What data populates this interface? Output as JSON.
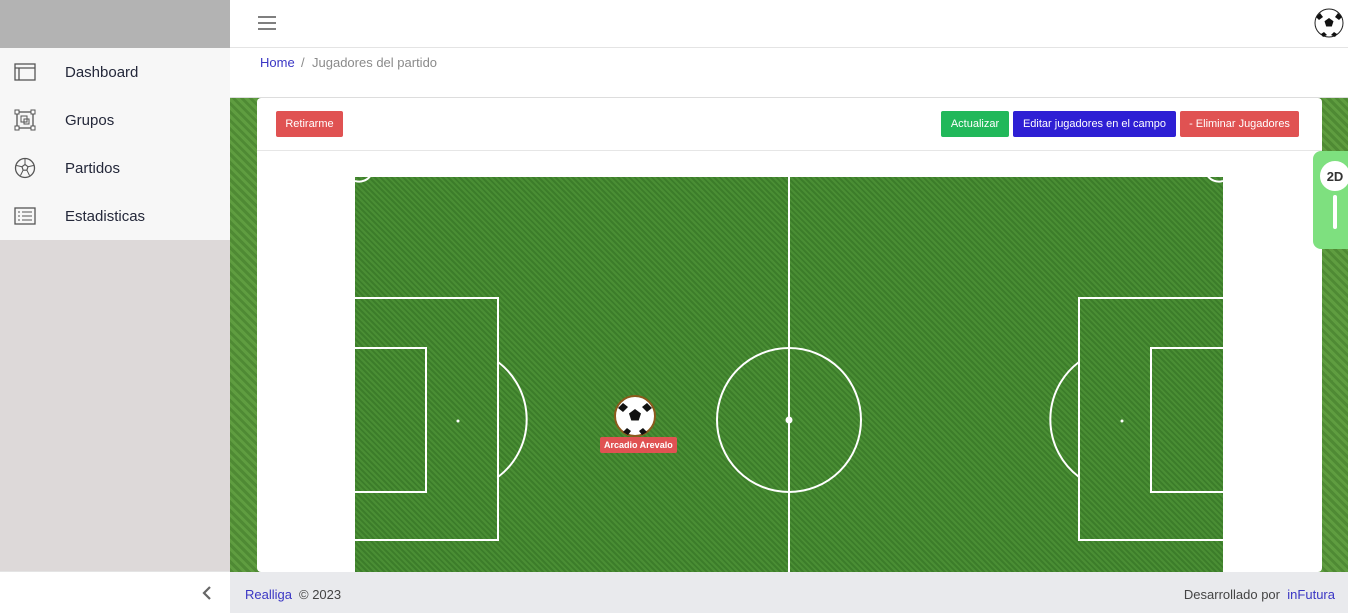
{
  "sidebar": {
    "items": [
      {
        "label": "Dashboard",
        "icon": "dashboard-icon"
      },
      {
        "label": "Grupos",
        "icon": "groups-icon"
      },
      {
        "label": "Partidos",
        "icon": "ball-icon"
      },
      {
        "label": "Estadisticas",
        "icon": "stats-icon"
      }
    ]
  },
  "breadcrumb": {
    "home": "Home",
    "separator": "/",
    "current": "Jugadores del partido"
  },
  "actions": {
    "leave": "Retirarme",
    "refresh": "Actualizar",
    "edit_players": "Editar jugadores en el campo",
    "remove_players": "- Eliminar Jugadores"
  },
  "view_toggle": {
    "label": "2D"
  },
  "pitch": {
    "players": [
      {
        "name": "Arcadio Arevalo"
      }
    ]
  },
  "footer": {
    "brand": "Realliga",
    "copyright": "© 2023",
    "developed_by": "Desarrollado por",
    "company": "inFutura"
  },
  "colors": {
    "primary_link": "#3a36c4",
    "danger": "#e05252",
    "success": "#21b85a",
    "info": "#2e1fd4",
    "toggle": "#7ee07f"
  }
}
